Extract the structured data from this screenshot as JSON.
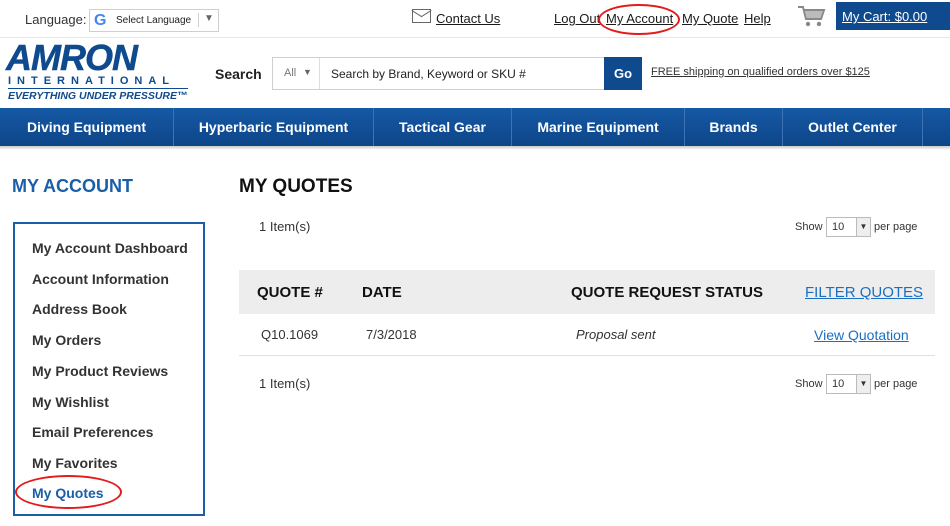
{
  "topbar": {
    "language_label": "Language:",
    "language_select": "Select Language",
    "contact_label": "Contact Us",
    "logout_label": "Log Out",
    "account_label": "My Account",
    "quote_label": "My Quote",
    "help_label": "Help",
    "cart_label": "My Cart: $0.00"
  },
  "header": {
    "logo_name": "AMRON",
    "logo_sub": "INTERNATIONAL",
    "logo_tagline": "EVERYTHING UNDER PRESSURE™",
    "search_label": "Search",
    "search_category": "All",
    "search_placeholder": "Search by Brand, Keyword or SKU #",
    "go_label": "Go",
    "shipping_text": "FREE shipping on qualified orders over $125"
  },
  "nav": {
    "items": [
      {
        "label": "Diving Equipment"
      },
      {
        "label": "Hyperbaric Equipment"
      },
      {
        "label": "Tactical Gear"
      },
      {
        "label": "Marine Equipment"
      },
      {
        "label": "Brands"
      },
      {
        "label": "Outlet Center"
      }
    ]
  },
  "sidebar": {
    "title": "MY ACCOUNT",
    "items": [
      {
        "label": "My Account Dashboard"
      },
      {
        "label": "Account Information"
      },
      {
        "label": "Address Book"
      },
      {
        "label": "My Orders"
      },
      {
        "label": "My Product Reviews"
      },
      {
        "label": "My Wishlist"
      },
      {
        "label": "Email Preferences"
      },
      {
        "label": "My Favorites"
      },
      {
        "label": "My Quotes",
        "active": true
      }
    ]
  },
  "main": {
    "title": "MY QUOTES",
    "item_count": "1 Item(s)",
    "show_label": "Show",
    "per_page_value": "10",
    "per_page_label": "per page",
    "columns": {
      "quote": "QUOTE #",
      "date": "DATE",
      "status": "QUOTE REQUEST STATUS",
      "filter": "FILTER QUOTES"
    },
    "rows": [
      {
        "quote": "Q10.1069",
        "date": "7/3/2018",
        "status": "Proposal sent",
        "action": "View Quotation"
      }
    ]
  },
  "colors": {
    "brand_blue": "#0f4a8e",
    "link_blue": "#1a6fc2",
    "highlight_red": "#e31b1b"
  },
  "icons": [
    "google-icon",
    "mail-icon",
    "cart-icon",
    "chevron-down-icon"
  ]
}
